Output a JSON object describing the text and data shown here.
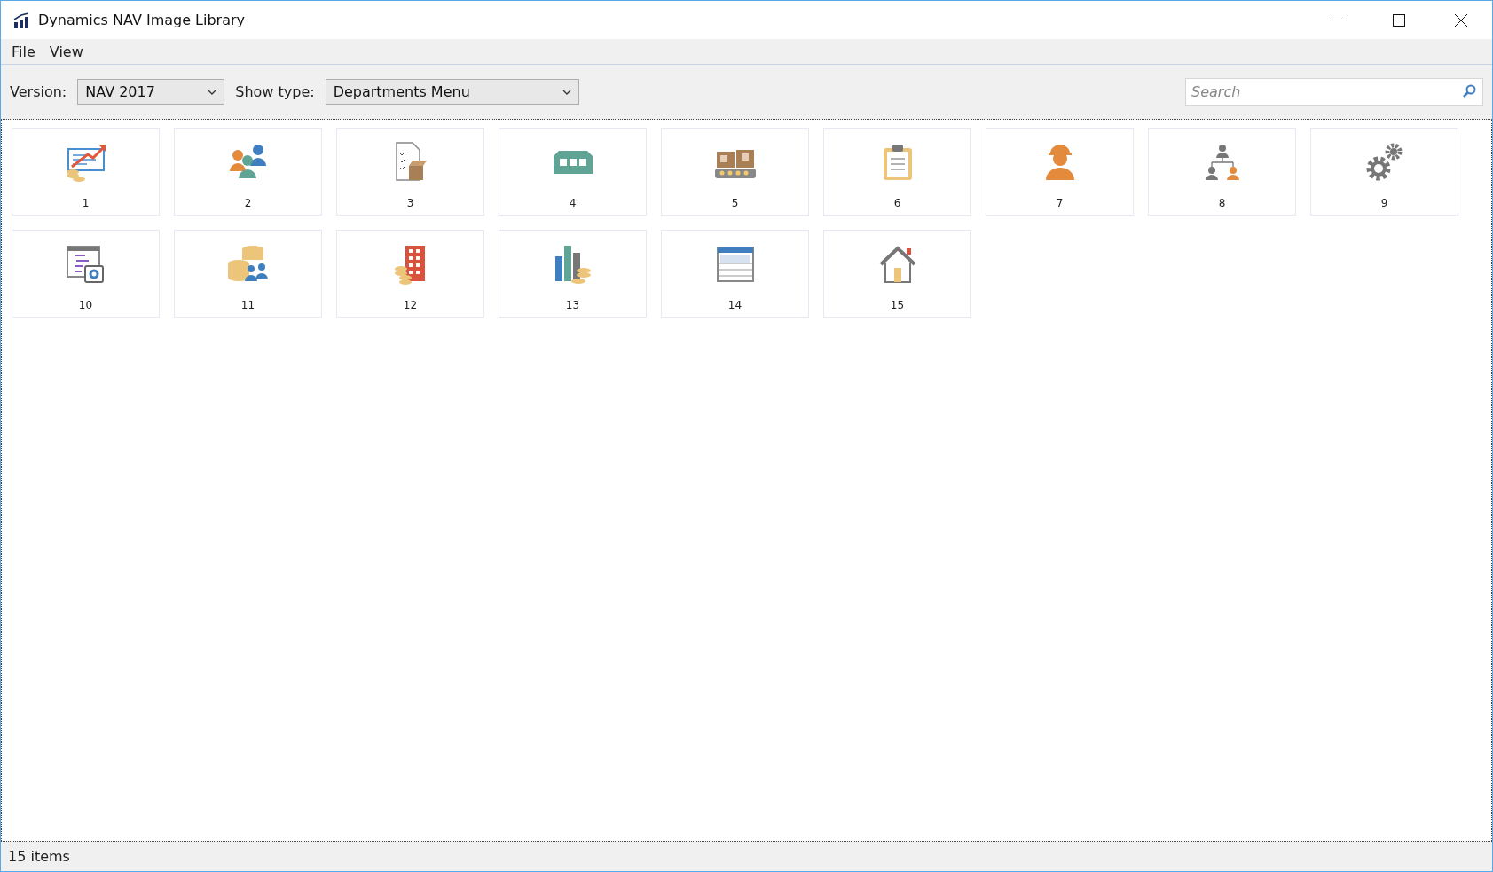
{
  "window": {
    "title": "Dynamics NAV Image Library"
  },
  "menu": [
    {
      "label": "File"
    },
    {
      "label": "View"
    }
  ],
  "toolbar": {
    "version_label": "Version:",
    "version_value": "NAV 2017",
    "type_label": "Show type:",
    "type_value": "Departments Menu",
    "search": {
      "placeholder": "Search"
    }
  },
  "items": [
    {
      "label": "1",
      "kind": "report"
    },
    {
      "label": "2",
      "kind": "people"
    },
    {
      "label": "3",
      "kind": "checklist"
    },
    {
      "label": "4",
      "kind": "warehouse"
    },
    {
      "label": "5",
      "kind": "conveyor"
    },
    {
      "label": "6",
      "kind": "clipboard"
    },
    {
      "label": "7",
      "kind": "worker"
    },
    {
      "label": "8",
      "kind": "orgchart"
    },
    {
      "label": "9",
      "kind": "gears"
    },
    {
      "label": "10",
      "kind": "tablesettings"
    },
    {
      "label": "11",
      "kind": "coinspeople"
    },
    {
      "label": "12",
      "kind": "building"
    },
    {
      "label": "13",
      "kind": "bars"
    },
    {
      "label": "14",
      "kind": "table"
    },
    {
      "label": "15",
      "kind": "house"
    }
  ],
  "status_bar": {
    "text": "15 items"
  }
}
